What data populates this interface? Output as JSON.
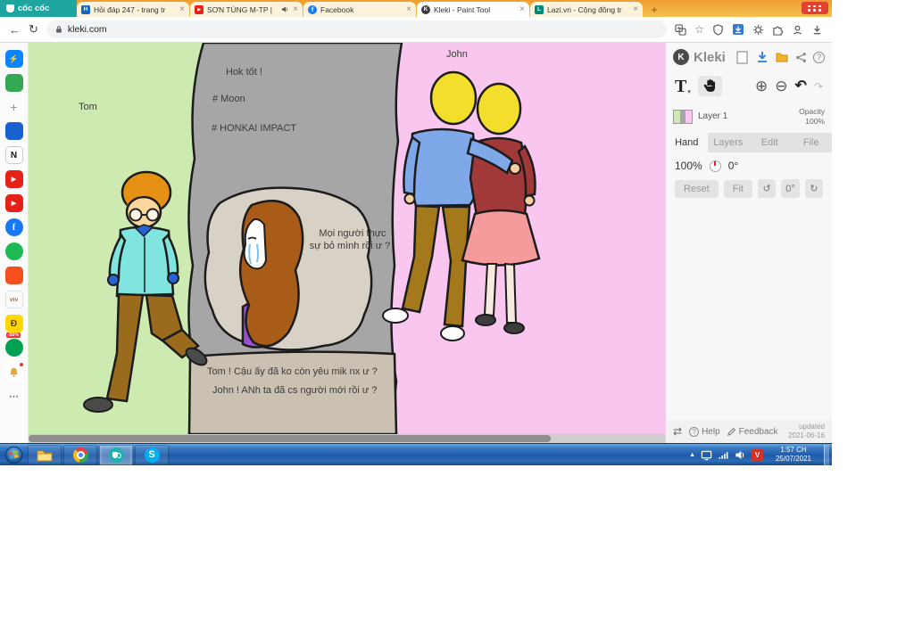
{
  "browser": {
    "brand": "cốc cốc",
    "tabs": [
      {
        "glyph": "H",
        "title": "Hỏi đáp 247 - trang tr"
      },
      {
        "glyph": "▶",
        "title": "SƠN TÙNG M-TP |"
      },
      {
        "glyph": "f",
        "title": "Facebook"
      },
      {
        "glyph": "K",
        "title": "Kleki - Paint Tool"
      },
      {
        "glyph": "L",
        "title": "Lazi.vn - Cộng đồng tr"
      }
    ],
    "close_glyph": "×",
    "new_tab_glyph": "+",
    "back_glyph": "←",
    "refresh_glyph": "↻",
    "url": "kleki.com",
    "star_glyph": "☆"
  },
  "sidebar": {
    "apps": [
      {
        "name": "messenger",
        "glyph": "⚡"
      },
      {
        "name": "app-green",
        "glyph": ""
      },
      {
        "name": "add-app",
        "glyph": "+"
      },
      {
        "name": "app-blue",
        "glyph": ""
      },
      {
        "name": "notion",
        "glyph": "N"
      },
      {
        "name": "youtube-1",
        "glyph": "▶"
      },
      {
        "name": "youtube-2",
        "glyph": "▶"
      },
      {
        "name": "facebook",
        "glyph": "f"
      },
      {
        "name": "app-green-circle",
        "glyph": ""
      },
      {
        "name": "app-orange",
        "glyph": ""
      },
      {
        "name": "vtv",
        "glyph": "vtv"
      },
      {
        "name": "app-yellow",
        "glyph": "Đ",
        "badge": "-50%"
      },
      {
        "name": "app-teal",
        "glyph": ""
      },
      {
        "name": "notifications",
        "glyph": ""
      },
      {
        "name": "more",
        "glyph": "⋯"
      }
    ]
  },
  "canvas": {
    "tom_label": "Tom",
    "john_label": "John",
    "hok": "Hok tốt !",
    "moon": "# Moon",
    "honkai": "# HONKAI IMPACT",
    "bubble_line1": "Mọi người thực",
    "bubble_line2": "sự bỏ mình rồi ư ?",
    "bottom_line1": "Tom ! Cậu ấy đã ko còn yêu mik nx ư ?",
    "bottom_line2": "John ! ANh ta đã cs người mới rồi ư ?"
  },
  "kleki": {
    "title": "Kleki",
    "logo_glyph": "K",
    "text_tool_glyph": "T",
    "caret_glyph": "▾",
    "zoom_in_glyph": "⊕",
    "zoom_out_glyph": "⊖",
    "undo_glyph": "↶",
    "redo_glyph": "↷",
    "help_q_glyph": "?",
    "layer_name": "Layer 1",
    "opacity_label": "Opacity",
    "opacity_value": "100%",
    "tabs": [
      "Hand",
      "Layers",
      "Edit",
      "File"
    ],
    "zoom_value": "100%",
    "angle_value": "0°",
    "reset_label": "Reset",
    "fit_label": "Fit",
    "rotate_left_glyph": "↺",
    "rotate_reset_label": "0°",
    "rotate_right_glyph": "↻",
    "swap_glyph": "⇄",
    "help_label": "Help",
    "feedback_label": "Feedback",
    "updated_label": "updated",
    "updated_date": "2021-06-16"
  },
  "taskbar": {
    "time": "1:57 CH",
    "date": "25/07/2021",
    "ime_glyph": "V",
    "skype_glyph": "S",
    "tray_chevron": "▲"
  },
  "colors": {
    "coccoc_teal": "#1fa5a0",
    "tab_strip_orange": "#f2a93b",
    "taskbar_blue": "#2a6cb3",
    "kleki_accent_blue": "#2f7bd9",
    "canvas_green": "#cdeab0",
    "canvas_pink": "#f8c6ee",
    "canvas_gray": "#a6a6a6"
  }
}
